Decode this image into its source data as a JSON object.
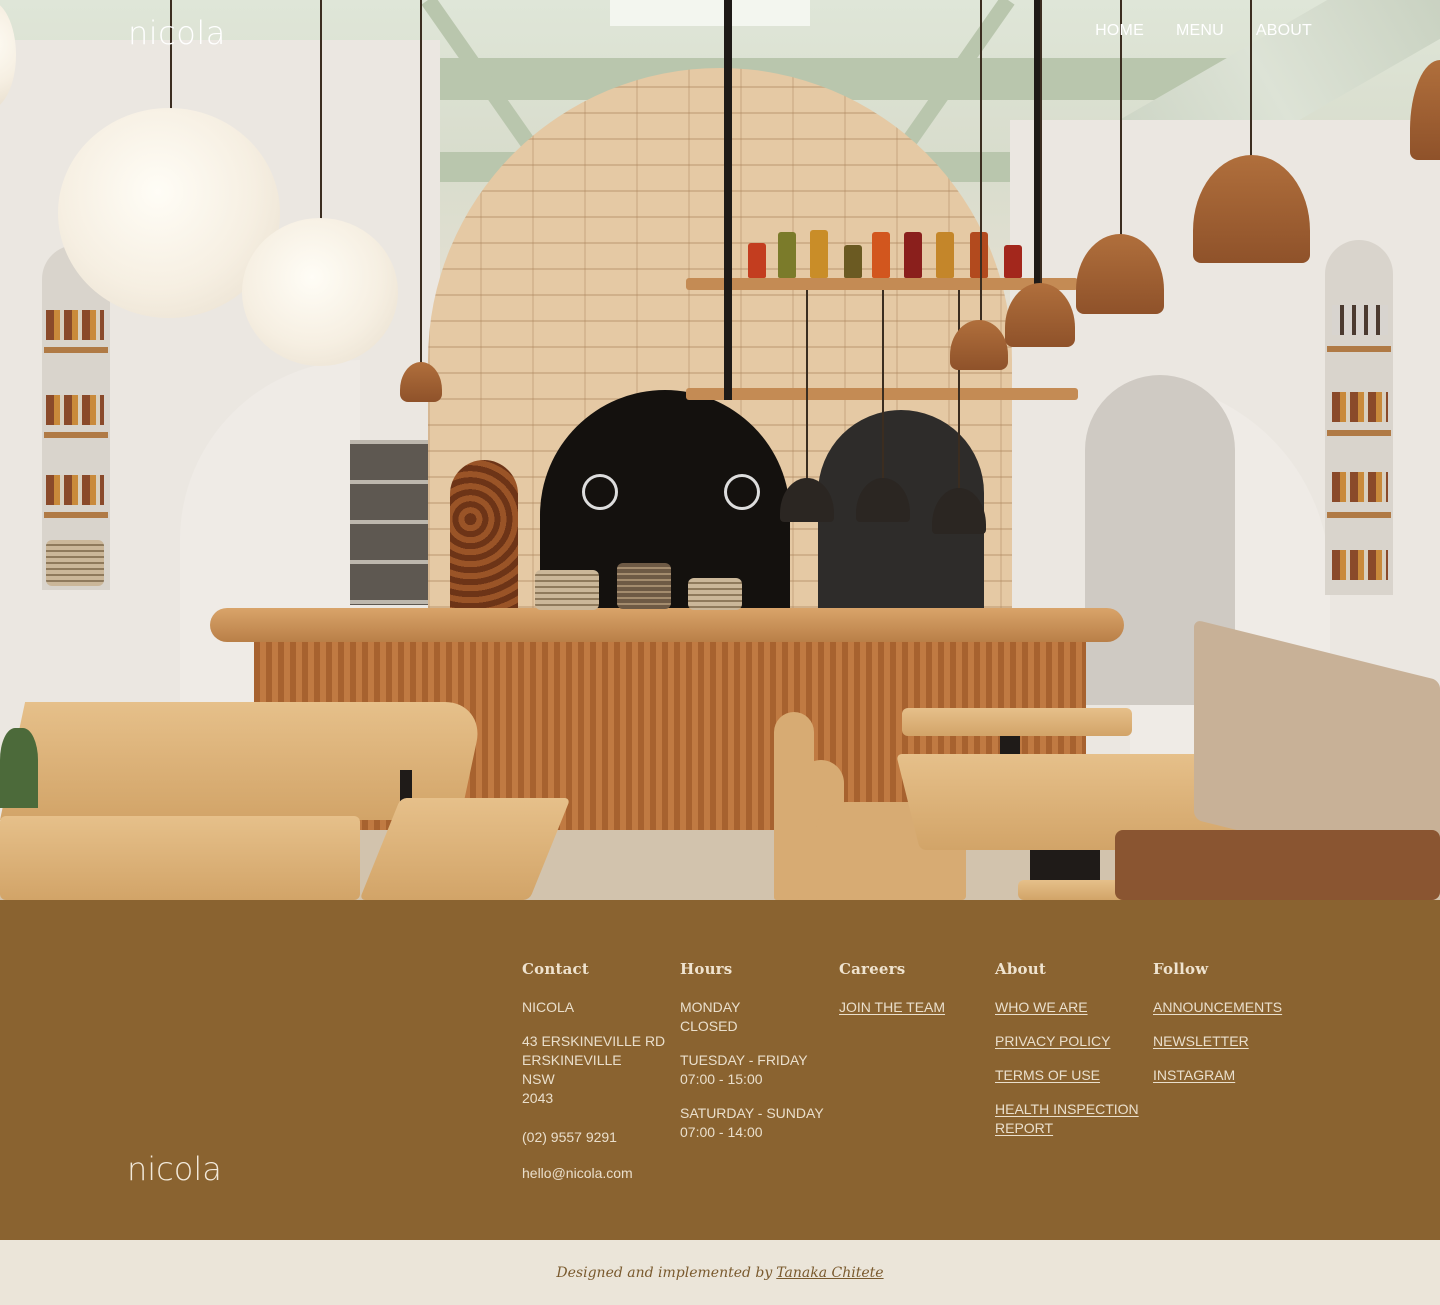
{
  "header": {
    "brand": "nicola",
    "nav": [
      {
        "label": "HOME"
      },
      {
        "label": "MENU"
      },
      {
        "label": "ABOUT"
      }
    ]
  },
  "hero": {
    "image": "restaurant-interior-photo"
  },
  "footer": {
    "brand": "nicola",
    "contact": {
      "heading": "Contact",
      "name": "NICOLA",
      "address_line1": "43 ERSKINEVILLE RD",
      "address_line2": "ERSKINEVILLE",
      "address_line3": "NSW",
      "address_line4": "2043",
      "phone": "(02) 9557 9291",
      "email": "hello@nicola.com"
    },
    "hours": {
      "heading": "Hours",
      "day1": "MONDAY",
      "time1": "CLOSED",
      "day2": "TUESDAY - FRIDAY",
      "time2": "07:00 - 15:00",
      "day3": "SATURDAY - SUNDAY",
      "time3": "07:00 - 14:00"
    },
    "careers": {
      "heading": "Careers",
      "link1": "JOIN THE TEAM"
    },
    "about": {
      "heading": "About",
      "link1": "WHO WE ARE",
      "link2": "PRIVACY POLICY",
      "link3": "TERMS OF USE",
      "link4_line1": "HEALTH INSPECTION",
      "link4_line2": "REPORT"
    },
    "follow": {
      "heading": "Follow",
      "link1": "ANNOUNCEMENTS",
      "link2": "NEWSLETTER",
      "link3": "INSTAGRAM"
    }
  },
  "credits": {
    "text": "Designed and implemented by",
    "author": "Tanaka Chitete"
  },
  "colors": {
    "footer_bg": "#8a6330",
    "credits_bg": "#ebe5d9"
  }
}
